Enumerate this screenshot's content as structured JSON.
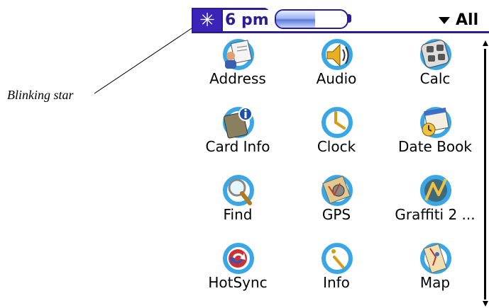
{
  "callout": {
    "text": "Blinking star"
  },
  "titlebar": {
    "star_glyph": "✳",
    "time": "6 pm",
    "battery_level": 0.55,
    "category": "All"
  },
  "apps": [
    {
      "label": "Address",
      "icon": "address-icon"
    },
    {
      "label": "Audio",
      "icon": "audio-icon"
    },
    {
      "label": "Calc",
      "icon": "calc-icon"
    },
    {
      "label": "Card Info",
      "icon": "card-info-icon"
    },
    {
      "label": "Clock",
      "icon": "clock-icon"
    },
    {
      "label": "Date Book",
      "icon": "date-book-icon"
    },
    {
      "label": "Find",
      "icon": "find-icon"
    },
    {
      "label": "GPS",
      "icon": "gps-icon"
    },
    {
      "label": "Graffiti 2 ...",
      "icon": "graffiti-icon"
    },
    {
      "label": "HotSync",
      "icon": "hotsync-icon"
    },
    {
      "label": "Info",
      "icon": "info-icon"
    },
    {
      "label": "Map",
      "icon": "map-icon"
    }
  ],
  "colors": {
    "accent": "#2c1c96",
    "ring": "#39a7e6"
  }
}
